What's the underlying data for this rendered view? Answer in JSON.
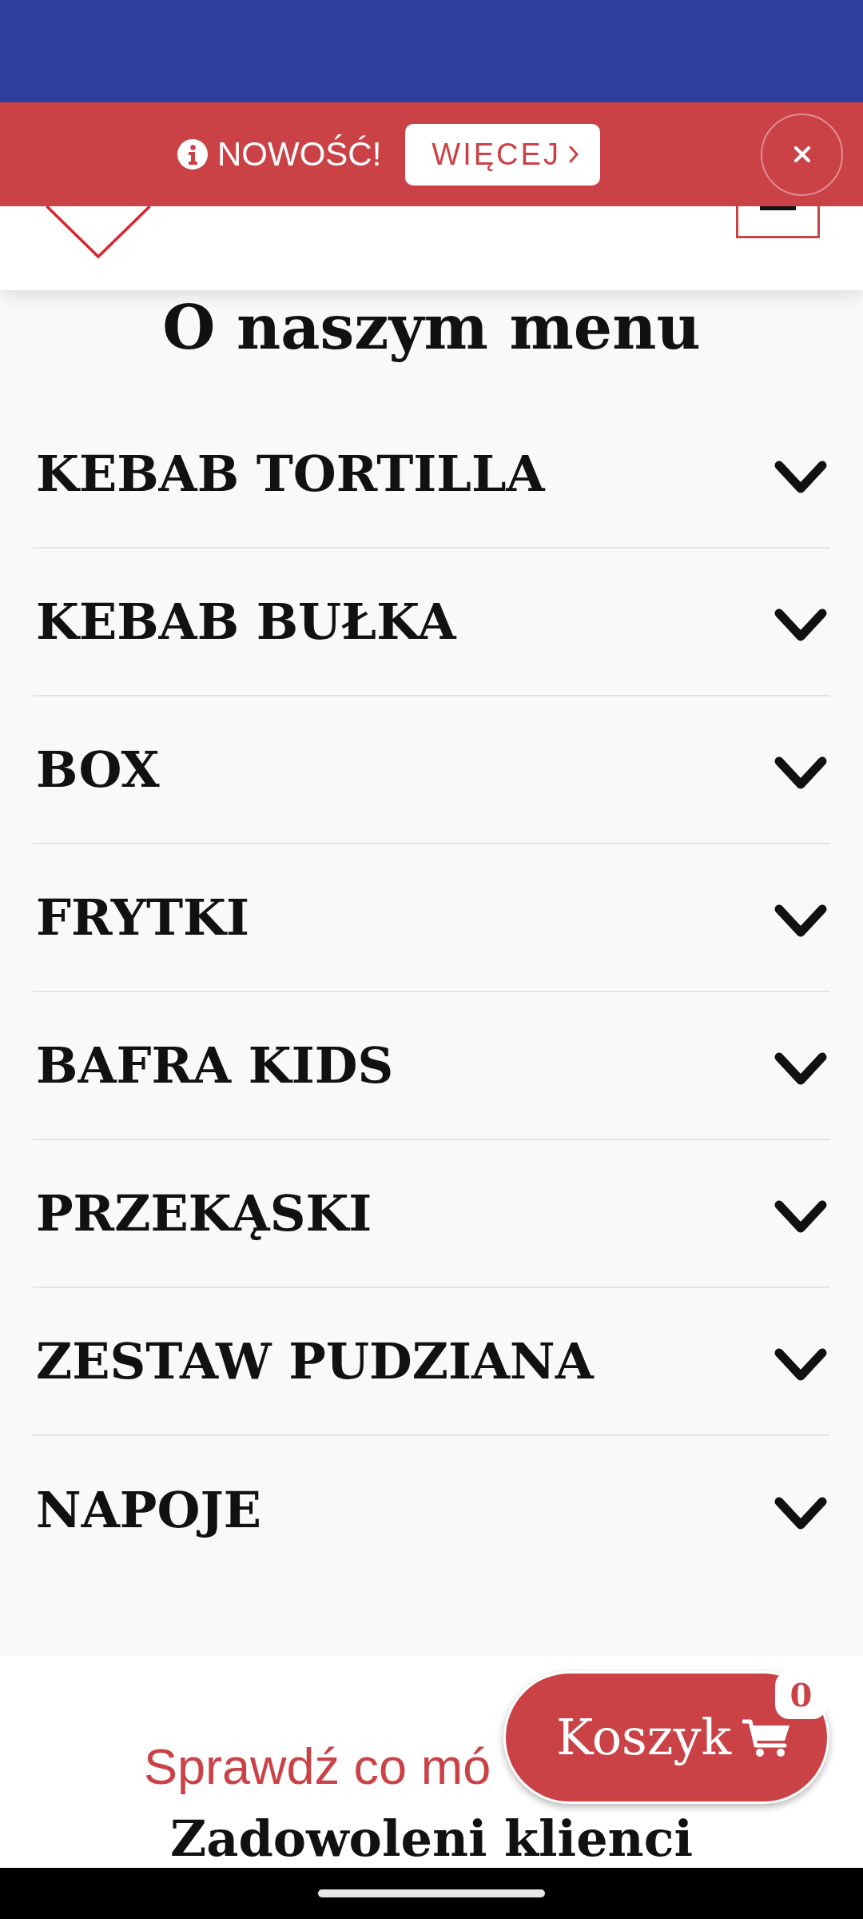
{
  "announcement_bar": {
    "label": "NOWOŚĆ!",
    "button": "WIĘCEJ"
  },
  "menu_section": {
    "title": "O naszym menu",
    "categories": [
      {
        "name": "KEBAB TORTILLA",
        "expanded": false
      },
      {
        "name": "KEBAB BUŁKA",
        "expanded": false
      },
      {
        "name": "BOX",
        "expanded": false
      },
      {
        "name": "FRYTKI",
        "expanded": false
      },
      {
        "name": "BAFRA KIDS",
        "expanded": false
      },
      {
        "name": "PRZEKĄSKI",
        "expanded": false
      },
      {
        "name": "ZESTAW PUDZIANA",
        "expanded": false
      },
      {
        "name": "NAPOJE",
        "expanded": false
      }
    ]
  },
  "testimonials": {
    "eyebrow": "Sprawdź co mó",
    "title": "Zadowoleni klienci"
  },
  "cart_button": {
    "label": "Koszyk",
    "count": "0"
  }
}
